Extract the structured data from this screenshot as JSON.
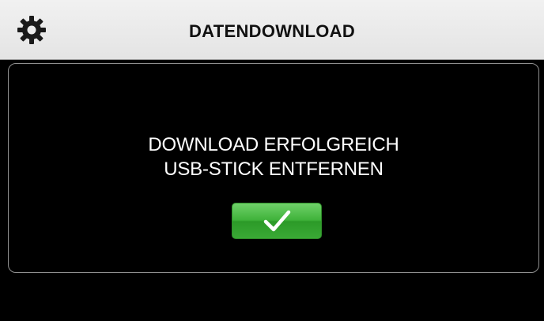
{
  "header": {
    "title": "DATENDOWNLOAD",
    "settings_icon": "gear-icon"
  },
  "dialog": {
    "message_line1": "DOWNLOAD ERFOLGREICH",
    "message_line2": "USB-STICK ENTFERNEN",
    "confirm_icon": "checkmark-icon"
  },
  "colors": {
    "header_bg": "#e9e9e9",
    "screen_bg": "#000000",
    "text_light": "#ffffff",
    "confirm_green": "#3fb23a"
  }
}
